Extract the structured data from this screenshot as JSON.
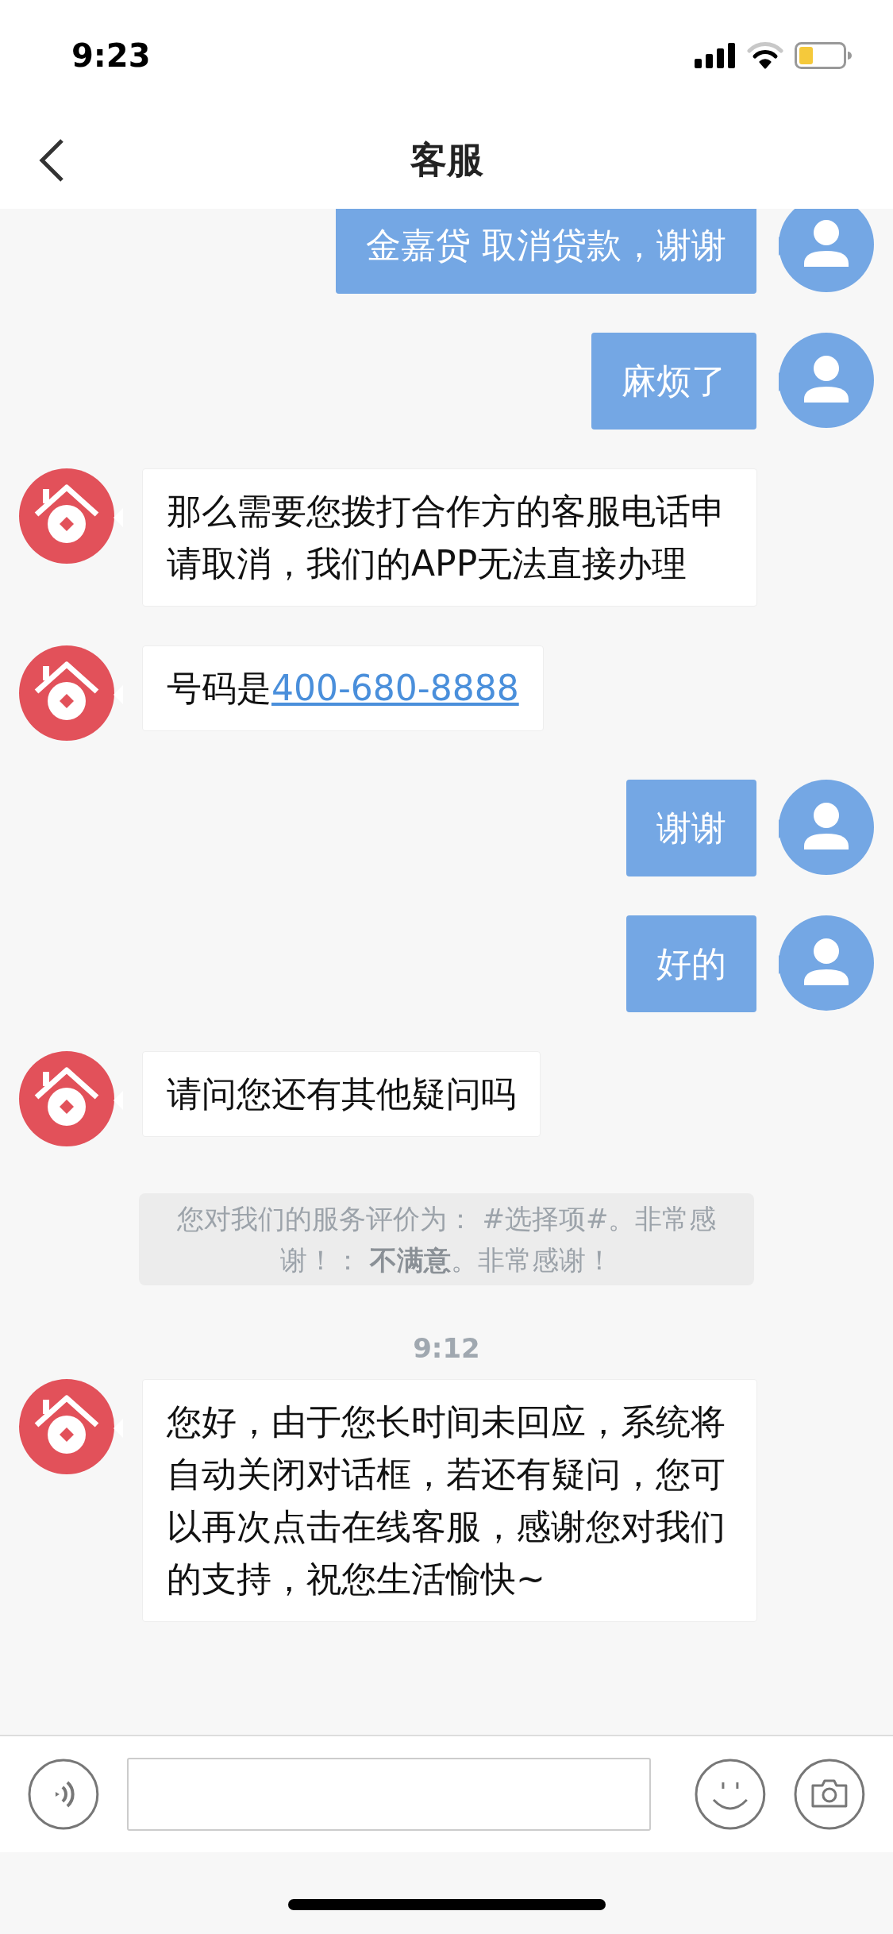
{
  "status_bar": {
    "time": "9:23"
  },
  "header": {
    "title": "客服"
  },
  "messages": [
    {
      "kind": "user",
      "text": "金嘉贷 取消贷款，谢谢"
    },
    {
      "kind": "user",
      "text": "麻烦了"
    },
    {
      "kind": "bot",
      "text": "那么需要您拨打合作方的客服电话申请取消，我们的APP无法直接办理"
    },
    {
      "kind": "bot",
      "text": "号码是",
      "link": "400-680-8888"
    },
    {
      "kind": "user",
      "text": "谢谢"
    },
    {
      "kind": "user",
      "text": "好的"
    },
    {
      "kind": "bot",
      "text": "请问您还有其他疑问吗"
    },
    {
      "kind": "notice",
      "text": "您对我们的服务评价为：  #选择项#。非常感谢！：  **不满意**。非常感谢！"
    },
    {
      "kind": "time",
      "text": "9:12"
    },
    {
      "kind": "bot",
      "text": "您好，由于您长时间未回应，系统将自动关闭对话框，若还有疑问，您可以再次点击在线客服，感谢您对我们的支持，祝您生活愉快~"
    }
  ]
}
